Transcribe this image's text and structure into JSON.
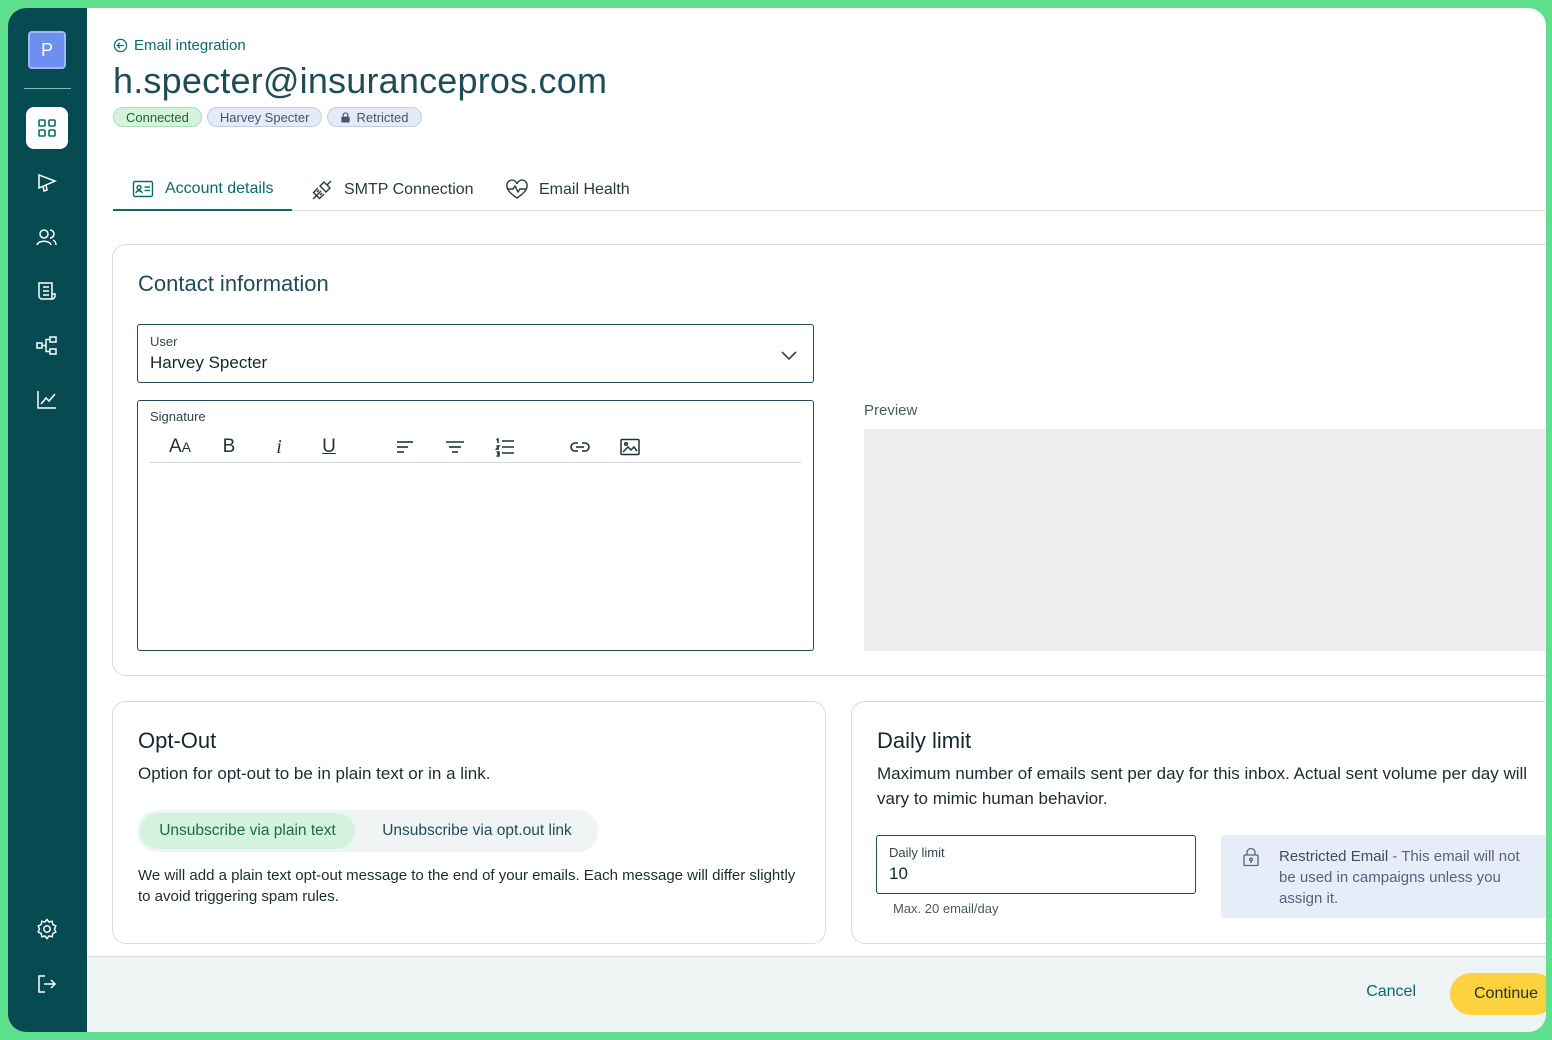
{
  "sidebar": {
    "logo_letter": "P",
    "items": [
      {
        "name": "dashboard-icon",
        "active": true
      },
      {
        "name": "campaign-icon",
        "active": false
      },
      {
        "name": "contacts-icon",
        "active": false
      },
      {
        "name": "templates-icon",
        "active": false
      },
      {
        "name": "workflow-icon",
        "active": false
      },
      {
        "name": "analytics-icon",
        "active": false
      }
    ],
    "bottom_items": [
      {
        "name": "settings-icon"
      },
      {
        "name": "logout-icon"
      }
    ]
  },
  "header": {
    "back_label": "Email integration",
    "title": "h.specter@insurancepros.com",
    "badges": {
      "connected": "Connected",
      "user": "Harvey Specter",
      "restricted": "Retricted"
    }
  },
  "tabs": [
    {
      "label": "Account details",
      "active": true
    },
    {
      "label": "SMTP Connection",
      "active": false
    },
    {
      "label": "Email Health",
      "active": false
    }
  ],
  "contact": {
    "title": "Contact information",
    "user_label": "User",
    "user_value": "Harvey Specter",
    "signature_label": "Signature",
    "preview_label": "Preview"
  },
  "optout": {
    "title": "Opt-Out",
    "description": "Option for opt-out to be in plain text or in a link.",
    "option_plain": "Unsubscribe via plain text",
    "option_link": "Unsubscribe via opt.out link",
    "info": "We will add a plain text opt-out message to the end of your emails. Each message will differ slightly to avoid triggering spam rules."
  },
  "daily_limit": {
    "title": "Daily limit",
    "description": "Maximum number of emails sent per day for this inbox. Actual sent volume per day will vary to mimic human behavior.",
    "field_label": "Daily limit",
    "field_value": "10",
    "helper": "Max. 20 email/day",
    "notice_strong": "Restricted Email",
    "notice_rest": " - This email will not be used in campaigns unless you assign it."
  },
  "footer": {
    "cancel_label": "Cancel",
    "continue_label": "Continue"
  },
  "colors": {
    "sidebar": "#064b52",
    "accent": "#0a6b68",
    "primary_button": "#fcd33e",
    "frame_border": "#5ee08f"
  }
}
